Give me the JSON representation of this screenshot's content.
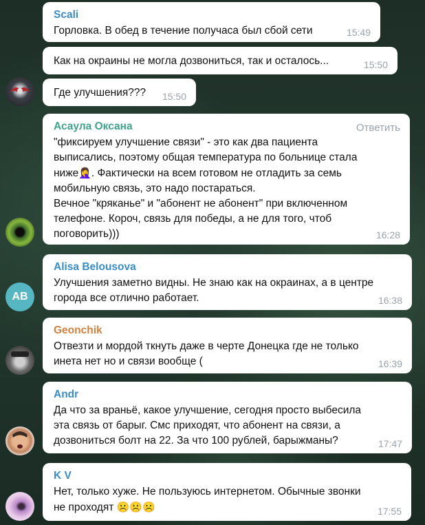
{
  "colors": {
    "sender_scali": "#3a8cc4",
    "sender_asaula": "#3fa38e",
    "sender_alisa": "#3a8cc4",
    "sender_geonchik": "#d2813e",
    "sender_andr": "#3a8cc4",
    "sender_kv": "#3a8cc4",
    "ab_avatar_bg": "#56b6c2"
  },
  "messages": [
    {
      "sender": "Scali",
      "text": "Горловка. В обед в течение получаса был сбой сети",
      "time": "15:49"
    },
    {
      "text": "Как на окраины не могла дозвониться, так и осталось...",
      "time": "15:50"
    },
    {
      "text": "Где улучшения???",
      "time": "15:50"
    },
    {
      "sender": "Асаула Оксана",
      "reply_label": "Ответить",
      "text1": "\"фиксируем улучшение связи\" - это как два пациента\nвыписались, поэтому общая температура по больнице стала\nниже",
      "emoji": "🤦‍♀️",
      "text2": ". Фактически на всем готовом не отладить за семь\nмобильную связь, это надо постараться.\nВечное \"кряканье\" и \"абонент не абонент\" при включенном\nтелефоне. Короч, связь для победы, а не для того, чтоб\nпоговорить)))",
      "time": "16:28"
    },
    {
      "sender": "Alisa Belousova",
      "avatar_initials": "AB",
      "text": "Улучшения заметно видны. Не знаю как на окраинах, а в центре\nгорода все отлично работает.",
      "time": "16:38"
    },
    {
      "sender": "Geonchik",
      "text": "Отвезти и мордой ткнуть даже в черте Донецка где не только\nинета нет но и связи вообще (",
      "time": "16:39"
    },
    {
      "sender": "Andr",
      "text": "Да что за враньё, какое улучшение, сегодня просто выбесила\nэта связь от барыг. Смс приходят, что абонент на связи, а\nдозвониться болт на 22. За что 100 рублей, барыжманы?",
      "time": "17:47"
    },
    {
      "sender": "K V",
      "text": "Нет, только хуже. Не пользуюсь интернетом. Обычные звонки\nне проходят ",
      "emojis": "☹️☹️☹️",
      "time": "17:55"
    }
  ]
}
